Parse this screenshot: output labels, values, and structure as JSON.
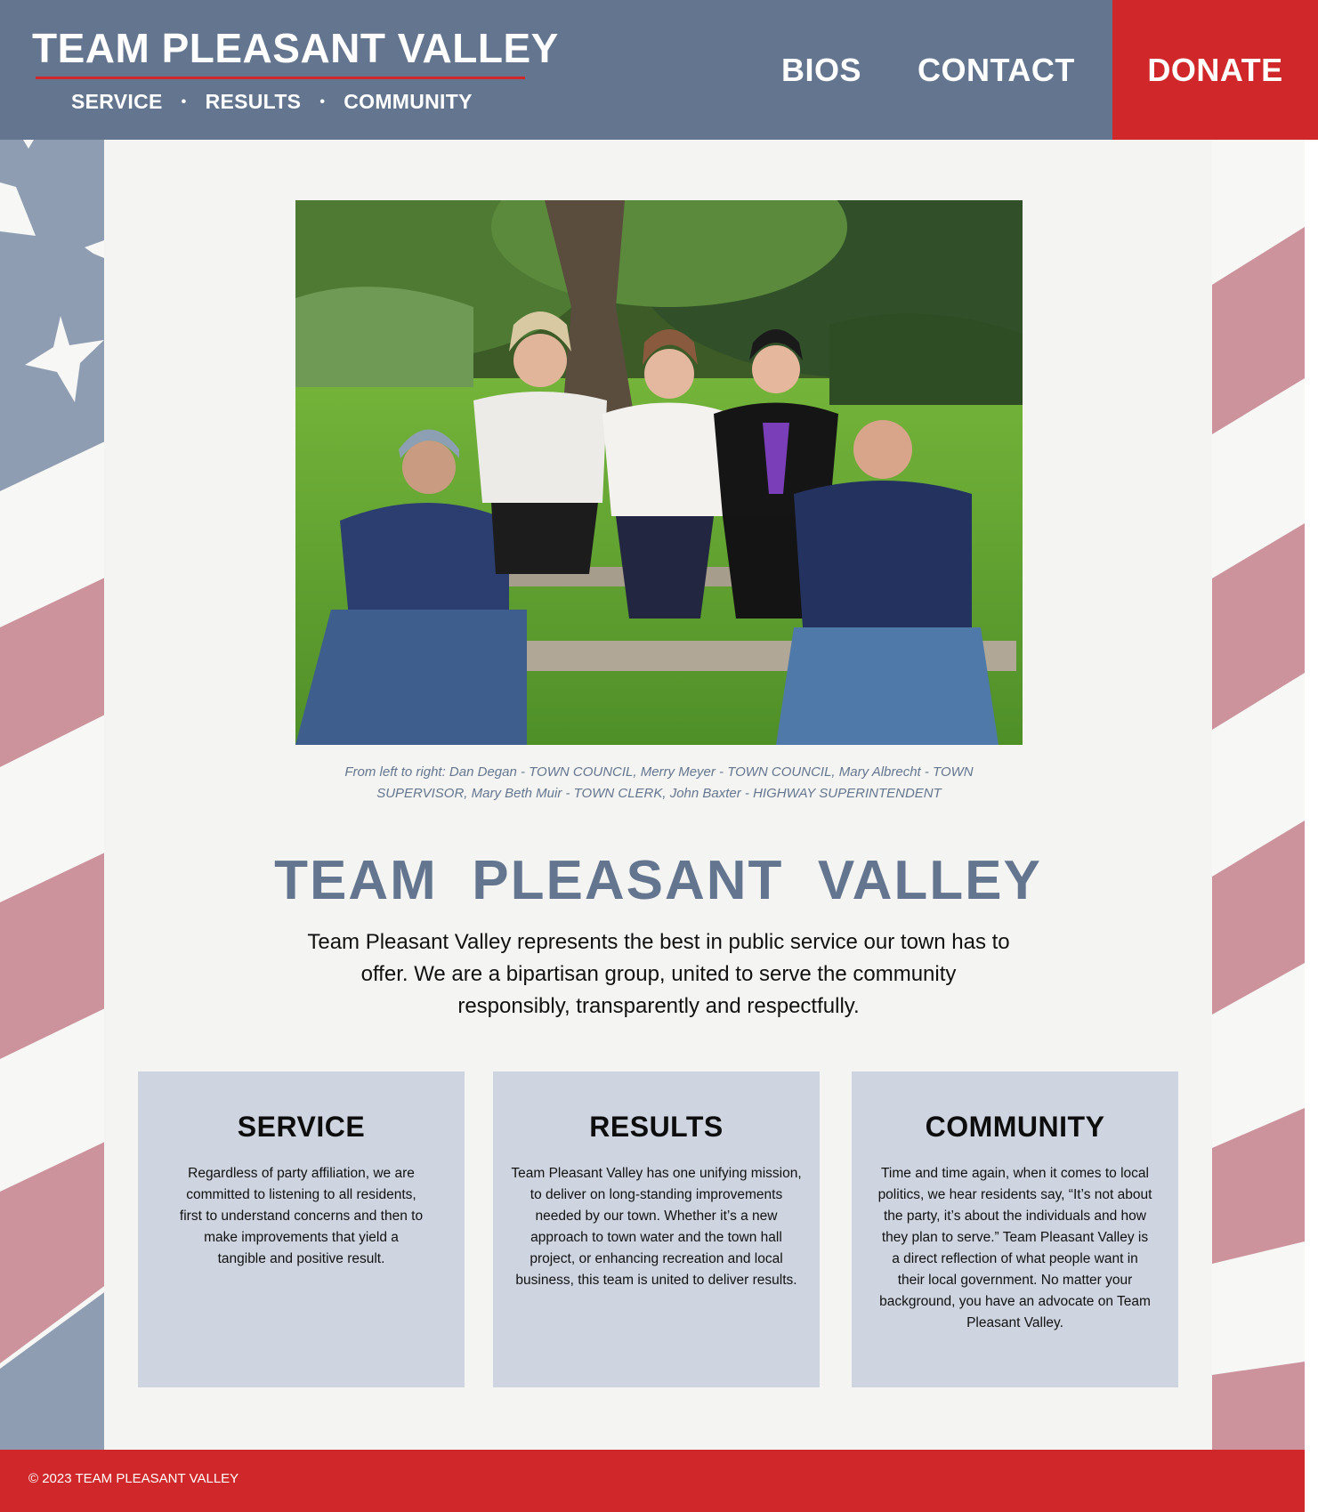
{
  "header": {
    "brand_title": "TEAM PLEASANT  VALLEY",
    "tagline": [
      "SERVICE",
      "RESULTS",
      "COMMUNITY"
    ],
    "tagline_separator": "•",
    "nav": {
      "bios": "BIOS",
      "contact": "CONTACT",
      "donate": "DONATE"
    }
  },
  "hero": {
    "caption_line1": "From left to right: Dan Degan - TOWN COUNCIL, Merry Meyer  - TOWN COUNCIL, Mary Albrecht - TOWN",
    "caption_line2": "SUPERVISOR, Mary Beth Muir - TOWN CLERK, John Baxter - HIGHWAY SUPERINTENDENT"
  },
  "main": {
    "heading": "TEAM  PLEASANT  VALLEY",
    "intro": "Team Pleasant Valley represents the best in public service our town has to offer. We are a bipartisan group, united to serve the community responsibly, transparently and respectfully."
  },
  "cards": [
    {
      "title": "SERVICE",
      "body": "Regardless of party affiliation, we are committed to listening to all residents, first to understand concerns and then to make improvements that yield a tangible and positive result."
    },
    {
      "title": "RESULTS",
      "body": "Team Pleasant Valley has one unifying mission, to deliver on long-standing improvements needed by our town. Whether it’s a new approach to town water and the town hall project, or enhancing recreation and local business, this team is united to deliver results."
    },
    {
      "title": "COMMUNITY",
      "body": "Time and time again, when it comes to local politics, we hear residents say, “It’s not about the party, it’s about the individuals and how they plan to serve.” Team Pleasant Valley is a direct reflection of what people want in their local government. No matter your background, you have an advocate on Team Pleasant Valley."
    }
  ],
  "footer": {
    "copyright": "© 2023 TEAM PLEASANT VALLEY"
  },
  "colors": {
    "brand_blue": "#64768f",
    "brand_red": "#d0282a",
    "card_bg": "#cfd5e0",
    "stripe_red": "#cc939d",
    "flag_blue": "#8f9db3"
  }
}
